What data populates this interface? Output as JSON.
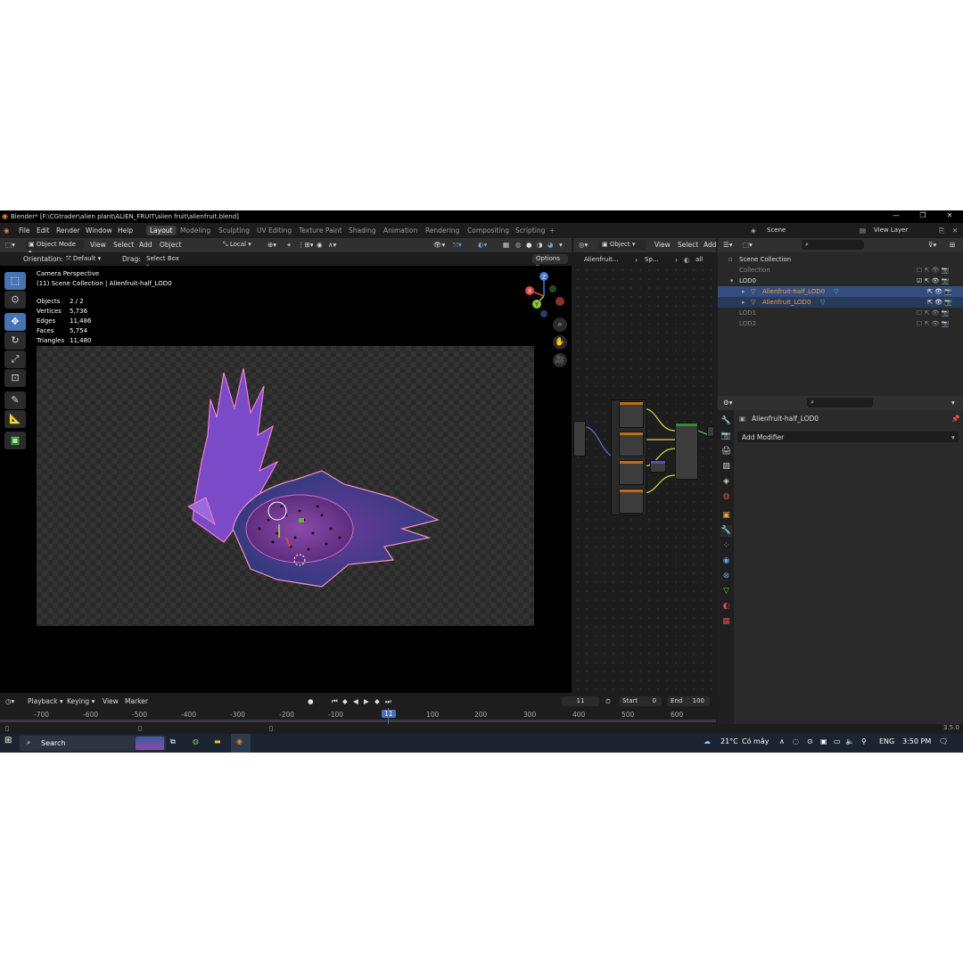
{
  "title": "Blender* [F:\\CGtrader\\alien plant\\ALIEN_FRUIT\\alien fruit\\alienfruit.blend]",
  "menu": [
    "File",
    "Edit",
    "Render",
    "Window",
    "Help"
  ],
  "workspaces": [
    "Layout",
    "Modeling",
    "Sculpting",
    "UV Editing",
    "Texture Paint",
    "Shading",
    "Animation",
    "Rendering",
    "Compositing",
    "Scripting"
  ],
  "active_workspace": "Layout",
  "scene_label": "Scene",
  "view_layer_label": "View Layer",
  "viewport": {
    "mode": "Object Mode",
    "menus": [
      "View",
      "Select",
      "Add",
      "Object"
    ],
    "pivot": "Local",
    "orientation_label": "Orientation:",
    "orientation": "Default",
    "drag_label": "Drag:",
    "drag": "Select Box",
    "options": "Options",
    "camera_text": "Camera Perspective",
    "collection_text": "(11) Scene Collection | Alienfruit-half_LOD0",
    "stats": [
      {
        "label": "Objects",
        "value": "2 / 2"
      },
      {
        "label": "Vertices",
        "value": "5,736"
      },
      {
        "label": "Edges",
        "value": "11,486"
      },
      {
        "label": "Faces",
        "value": "5,754"
      },
      {
        "label": "Triangles",
        "value": "11,480"
      }
    ],
    "gizmo": {
      "x": "X",
      "y": "Y",
      "z": "Z"
    }
  },
  "node_editor": {
    "mode": "Object",
    "menus": [
      "View",
      "Select",
      "Add"
    ],
    "breadcrumb": [
      "Alienfruit...",
      "Sp...",
      "all"
    ]
  },
  "outliner": {
    "root": "Scene Collection",
    "items": [
      {
        "name": "Collection",
        "indent": 0,
        "state": "dim"
      },
      {
        "name": "LOD0",
        "indent": 0,
        "state": "normal"
      },
      {
        "name": "Alienfruit-half_LOD0",
        "indent": 1,
        "state": "selected"
      },
      {
        "name": "Alienfruit_LOD0",
        "indent": 1,
        "state": "active"
      },
      {
        "name": "LOD1",
        "indent": 0,
        "state": "dim"
      },
      {
        "name": "LOD2",
        "indent": 0,
        "state": "dim"
      }
    ]
  },
  "properties": {
    "object_name": "Alienfruit-half_LOD0",
    "add_modifier": "Add Modifier"
  },
  "timeline": {
    "menus": [
      "Playback",
      "Keying",
      "View",
      "Marker"
    ],
    "current_frame": "11",
    "start_label": "Start",
    "start": "0",
    "end_label": "End",
    "end": "100",
    "ruler": [
      "-700",
      "-600",
      "-500",
      "-400",
      "-300",
      "-200",
      "-100",
      "11",
      "100",
      "200",
      "300",
      "400",
      "500",
      "600"
    ]
  },
  "version": "3.5.0",
  "taskbar": {
    "search": "Search",
    "weather": "21°C",
    "weather_text": "Có mây",
    "lang": "ENG",
    "time": "3:50 PM"
  },
  "colors": {
    "accent": "#4772b3",
    "selected_row": "#334d80",
    "active_object": "#f0a040"
  }
}
